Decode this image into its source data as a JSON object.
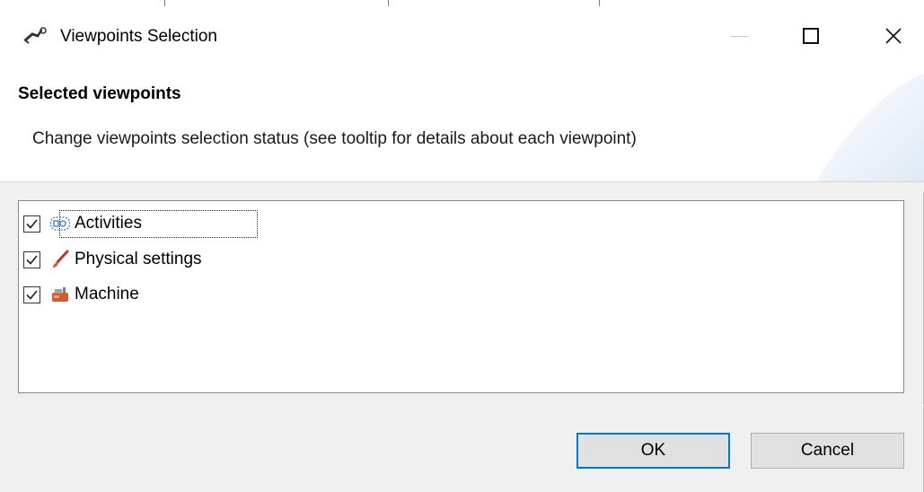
{
  "window": {
    "title": "Viewpoints Selection",
    "app_icon": "robot-arm-icon",
    "controls": {
      "minimize_icon": "minimize-icon",
      "maximize_icon": "maximize-icon",
      "close_icon": "close-icon",
      "close_glyph": "✕"
    }
  },
  "header": {
    "title": "Selected viewpoints",
    "description": "Change viewpoints selection status (see tooltip for details about each viewpoint)"
  },
  "viewpoints": [
    {
      "label": "Activities",
      "checked": true,
      "icon": "activities-icon"
    },
    {
      "label": "Physical settings",
      "checked": true,
      "icon": "brush-icon"
    },
    {
      "label": "Machine",
      "checked": true,
      "icon": "machine-icon"
    }
  ],
  "buttons": {
    "ok_label": "OK",
    "cancel_label": "Cancel"
  },
  "colors": {
    "accent": "#0078d7",
    "background": "#f0f0f0",
    "header_bg": "#ffffff"
  }
}
